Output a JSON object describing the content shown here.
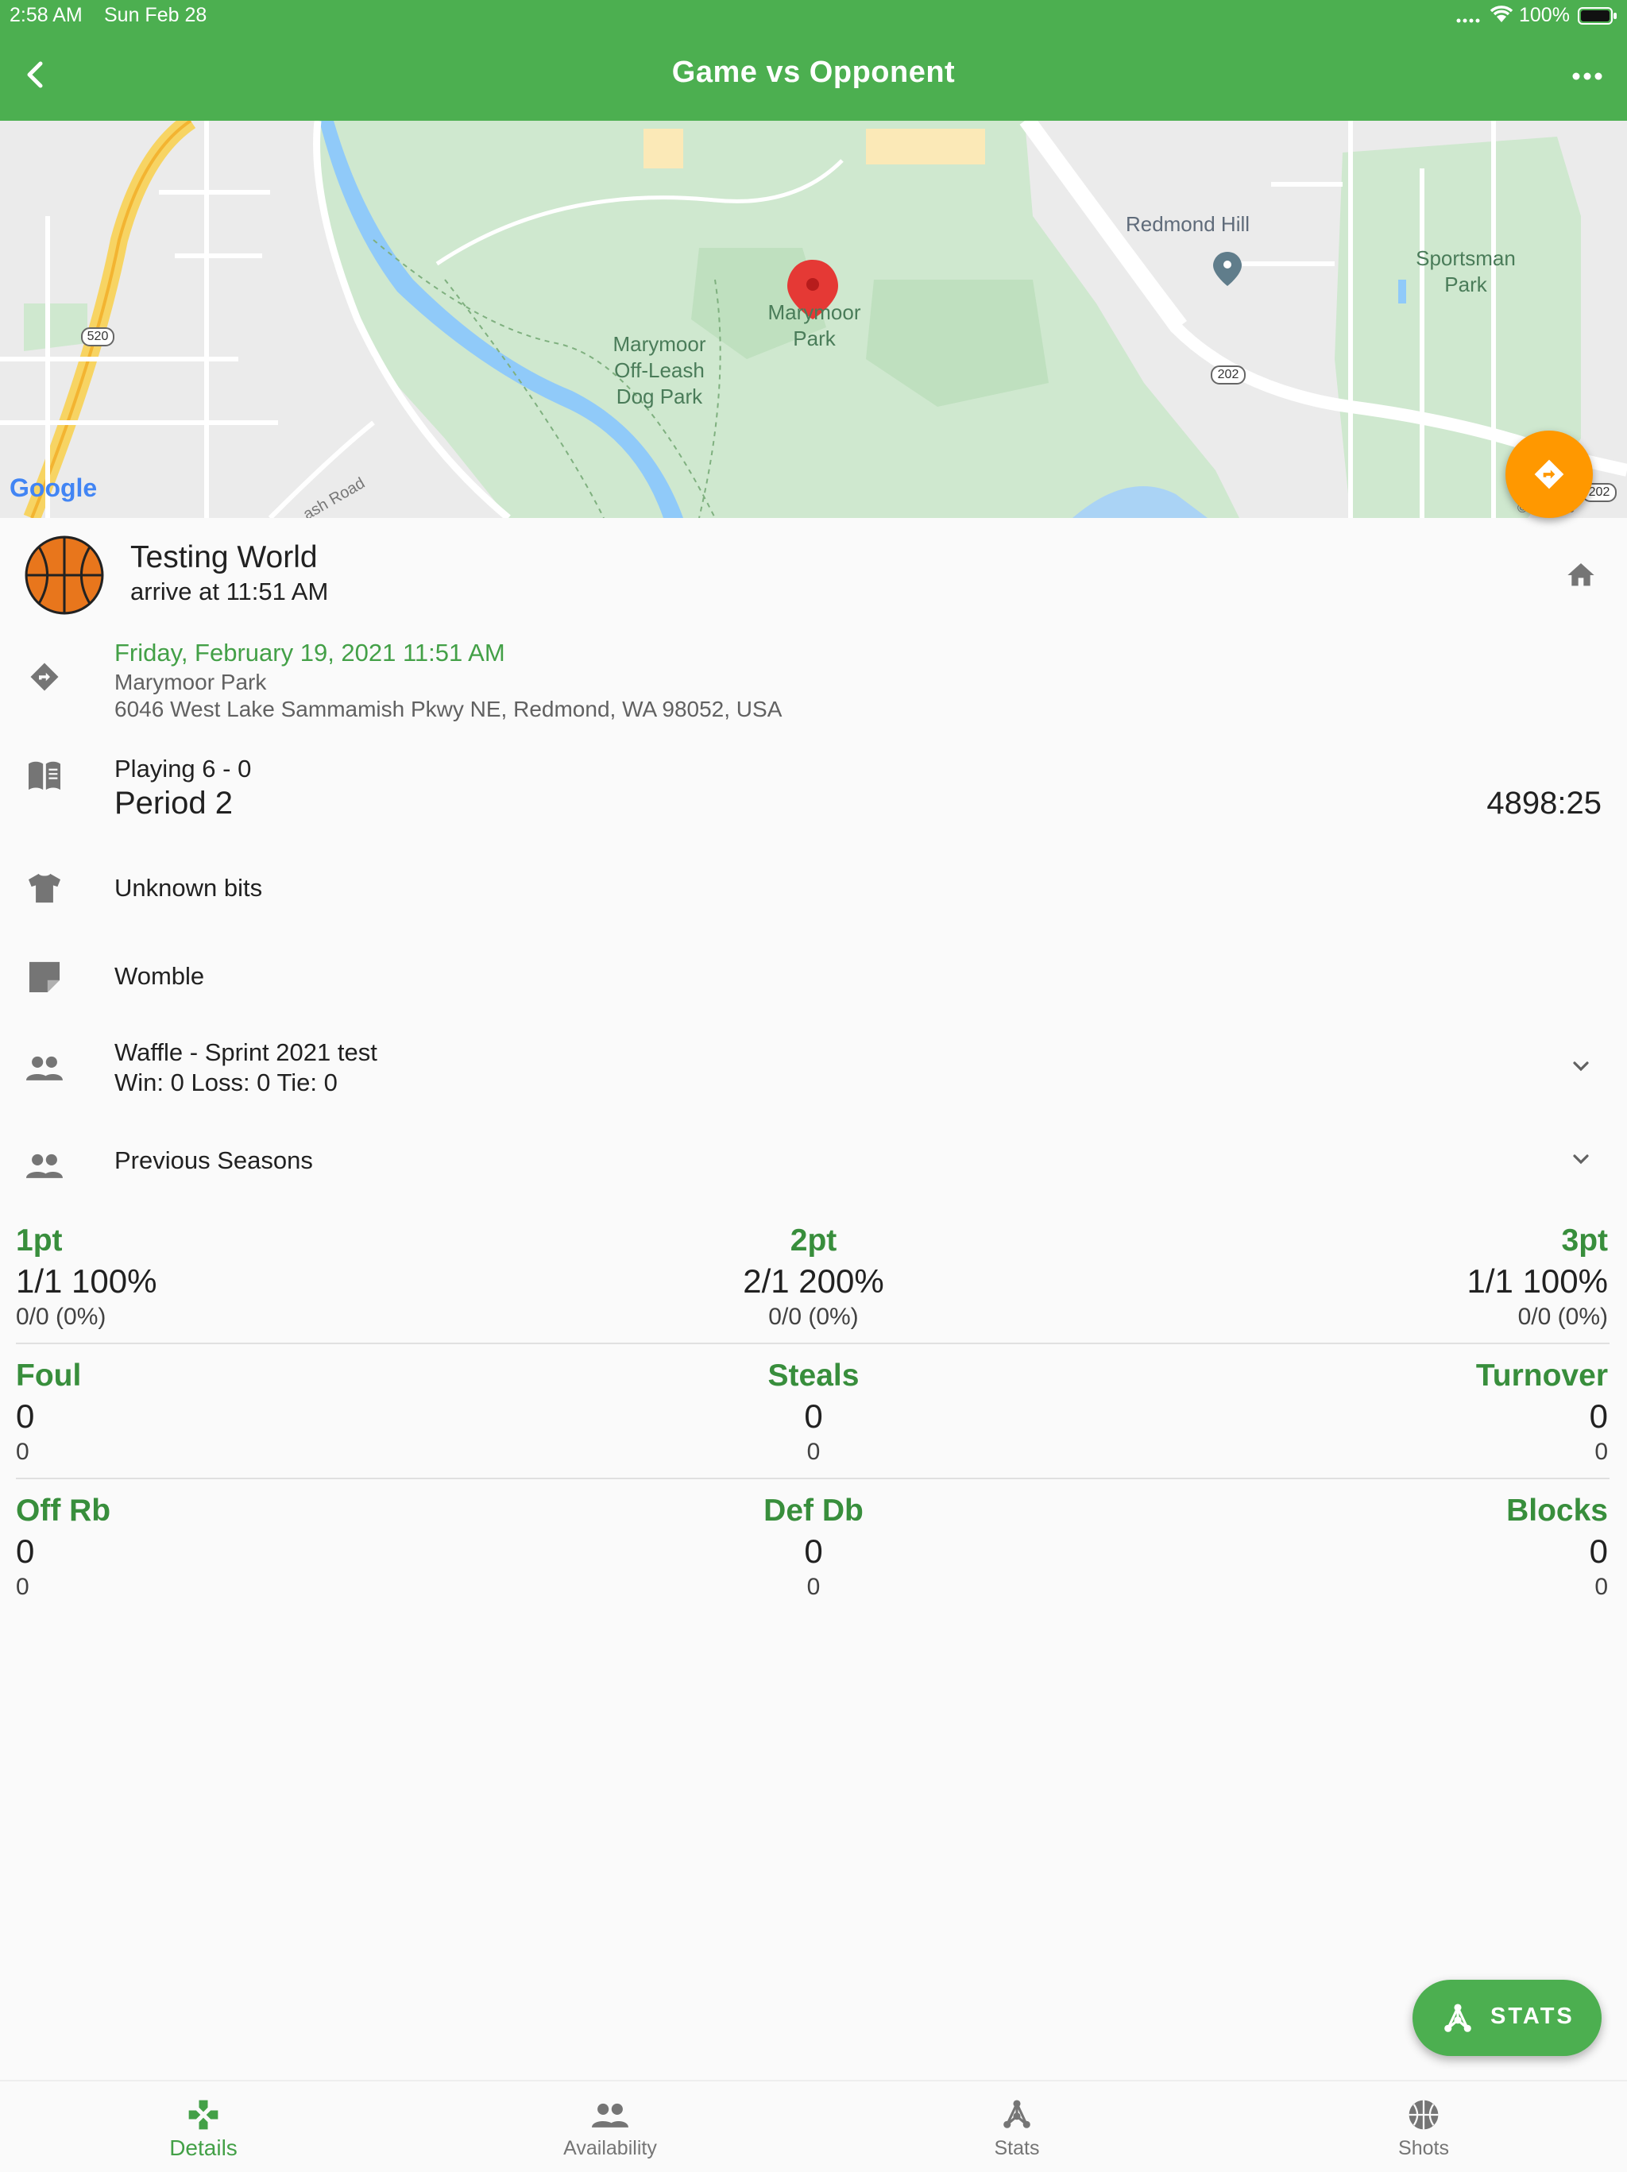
{
  "status_bar": {
    "time": "2:58 AM",
    "date": "Sun Feb 28",
    "battery": "100%"
  },
  "app_bar": {
    "title": "Game vs Opponent",
    "back_icon": "back-arrow-icon",
    "more_icon": "more-horiz-icon"
  },
  "map": {
    "labels": {
      "marymoor_park": "Marymoor\nPark",
      "dog_park": "Marymoor\nOff-Leash\nDog Park",
      "redmond_hill": "Redmond Hill",
      "sportsman_park": "Sportsman\nPark",
      "road": "ash Road",
      "hwy_520": "520",
      "hwy_202": "202",
      "hwy_202b": "202",
      "google": "Google",
      "copyright": "© Google"
    }
  },
  "team": {
    "name": "Testing World",
    "arrive": "arrive at 11:51 AM"
  },
  "event": {
    "datetime": "Friday, February 19, 2021 11:51 AM",
    "place": "Marymoor Park",
    "address": "6046 West Lake Sammamish Pkwy NE, Redmond, WA 98052, USA"
  },
  "game": {
    "playing": "Playing 6 - 0",
    "period": "Period 2",
    "clock": "4898:25"
  },
  "uniform": "Unknown bits",
  "notes": "Womble",
  "season": {
    "name": "Waffle - Sprint 2021 test",
    "record": "Win: 0 Loss: 0 Tie: 0"
  },
  "previous_seasons": "Previous Seasons",
  "stats": {
    "row1": [
      {
        "label": "1pt",
        "main": "1/1  100%",
        "sub": "0/0 (0%)"
      },
      {
        "label": "2pt",
        "main": "2/1  200%",
        "sub": "0/0 (0%)"
      },
      {
        "label": "3pt",
        "main": "1/1  100%",
        "sub": "0/0 (0%)"
      }
    ],
    "row2": [
      {
        "label": "Foul",
        "main": "0",
        "sub": "0"
      },
      {
        "label": "Steals",
        "main": "0",
        "sub": "0"
      },
      {
        "label": "Turnover",
        "main": "0",
        "sub": "0"
      }
    ],
    "row3": [
      {
        "label": "Off Rb",
        "main": "0",
        "sub": "0"
      },
      {
        "label": "Def Db",
        "main": "0",
        "sub": "0"
      },
      {
        "label": "Blocks",
        "main": "0",
        "sub": "0"
      }
    ]
  },
  "fab": {
    "label": "STATS"
  },
  "bottom_nav": [
    {
      "label": "Details",
      "active": true
    },
    {
      "label": "Availability"
    },
    {
      "label": "Stats"
    },
    {
      "label": "Shots"
    }
  ],
  "colors": {
    "primary": "#4caf50",
    "accent": "#ff9800",
    "stat_label": "#388e3c",
    "map_park": "#c8e6c9",
    "map_water": "#90caf9",
    "pin": "#e53935"
  }
}
